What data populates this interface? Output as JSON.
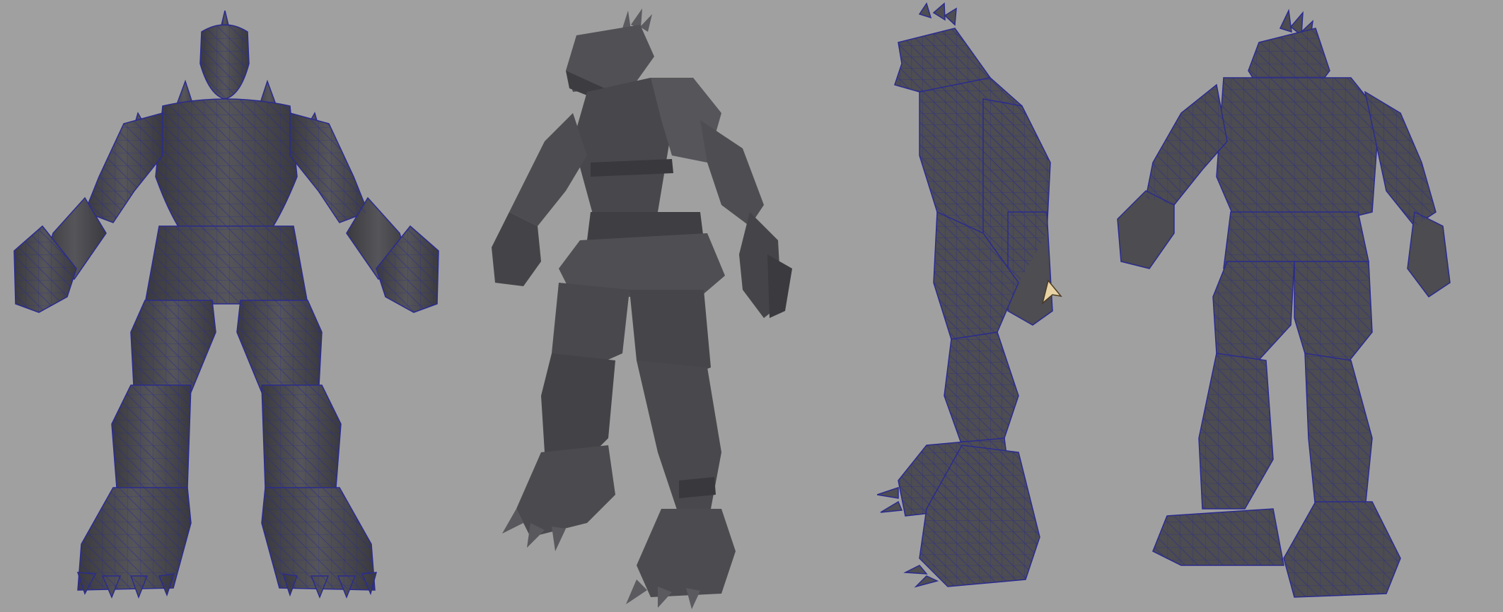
{
  "viewport": {
    "background": "#a0a0a0",
    "mesh_fill": "#4a4a4f",
    "mesh_shadow": "#36363a",
    "mesh_light": "#626267",
    "wire_color": "#2b2b8f"
  },
  "models": [
    {
      "view": "front",
      "wireframe": true
    },
    {
      "view": "perspective",
      "wireframe": false
    },
    {
      "view": "side",
      "wireframe": true
    },
    {
      "view": "back",
      "wireframe": true
    }
  ],
  "cursor": {
    "icon": "cursor-arrow-icon"
  }
}
